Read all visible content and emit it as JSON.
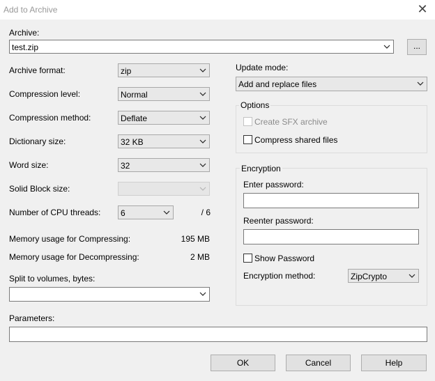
{
  "window": {
    "title": "Add to Archive"
  },
  "archive": {
    "label": "Archive:",
    "value": "test.zip",
    "browse_label": "..."
  },
  "left": {
    "format_label": "Archive format:",
    "format_value": "zip",
    "level_label": "Compression level:",
    "level_value": "Normal",
    "method_label": "Compression method:",
    "method_value": "Deflate",
    "dict_label": "Dictionary size:",
    "dict_value": "32 KB",
    "word_label": "Word size:",
    "word_value": "32",
    "solid_label": "Solid Block size:",
    "solid_value": "",
    "cpu_label": "Number of CPU threads:",
    "cpu_value": "6",
    "cpu_total": "/ 6",
    "mem_comp_label": "Memory usage for Compressing:",
    "mem_comp_value": "195 MB",
    "mem_decomp_label": "Memory usage for Decompressing:",
    "mem_decomp_value": "2 MB",
    "split_label": "Split to volumes, bytes:",
    "split_value": ""
  },
  "right": {
    "update_label": "Update mode:",
    "update_value": "Add and replace files",
    "options_title": "Options",
    "sfx_label": "Create SFX archive",
    "compress_shared_label": "Compress shared files",
    "encryption_title": "Encryption",
    "enter_pw_label": "Enter password:",
    "reenter_pw_label": "Reenter password:",
    "show_pw_label": "Show Password",
    "enc_method_label": "Encryption method:",
    "enc_method_value": "ZipCrypto"
  },
  "parameters": {
    "label": "Parameters:",
    "value": ""
  },
  "buttons": {
    "ok": "OK",
    "cancel": "Cancel",
    "help": "Help"
  },
  "icons": {
    "close": "close-icon",
    "dropdown": "chevron-down-icon"
  }
}
